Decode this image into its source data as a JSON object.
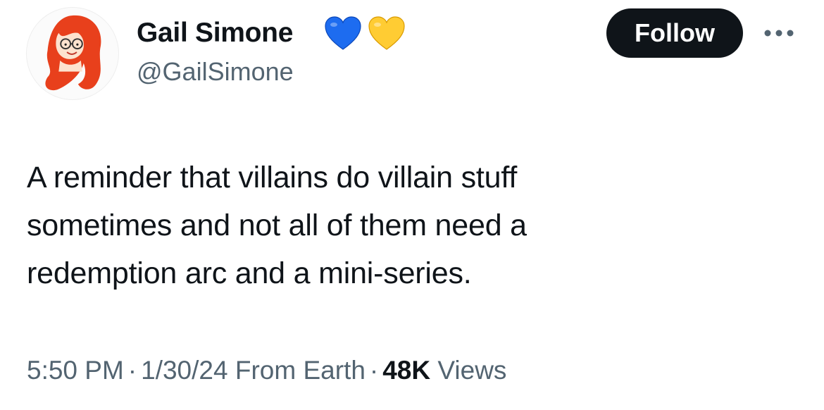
{
  "author": {
    "display_name": "Gail Simone",
    "handle": "@GailSimone",
    "avatar_icon": "cartoon-avatar-red-hair-glasses",
    "badges": [
      {
        "icon": "blue-heart-emoji",
        "color": "#1d6cf0"
      },
      {
        "icon": "yellow-heart-emoji",
        "color": "#ffcc33"
      }
    ]
  },
  "actions": {
    "follow_label": "Follow",
    "more_icon": "more-horizontal-icon"
  },
  "tweet": {
    "text": "A reminder that villains do villain stuff\nsometimes and not all of them need a\nredemption arc and a mini-series."
  },
  "meta": {
    "time": "5:50 PM",
    "date": "1/30/24",
    "location": "From Earth",
    "separator": "·",
    "views_count": "48K",
    "views_label": "Views"
  },
  "colors": {
    "text": "#0f1419",
    "secondary_text": "#536471",
    "button_bg": "#0f1419",
    "button_text": "#ffffff"
  }
}
